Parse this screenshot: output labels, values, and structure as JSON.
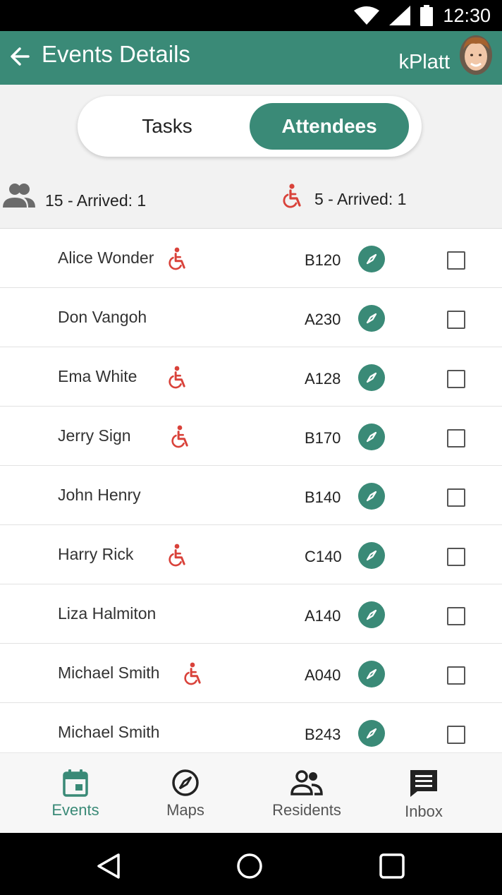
{
  "status_bar": {
    "time": "12:30"
  },
  "app_bar": {
    "title": "Events Details",
    "user": "kPlatt"
  },
  "tabs": [
    {
      "label": "Tasks",
      "active": false
    },
    {
      "label": "Attendees",
      "active": true
    }
  ],
  "counts": {
    "total": "15 - Arrived: 1",
    "wheelchair": "5 - Arrived: 1"
  },
  "attendees": [
    {
      "name": "Alice Wonder",
      "wheelchair": true,
      "room": "B120",
      "checked": false
    },
    {
      "name": "Don Vangoh",
      "wheelchair": false,
      "room": "A230",
      "checked": false
    },
    {
      "name": "Ema White",
      "wheelchair": true,
      "room": "A128",
      "checked": false
    },
    {
      "name": "Jerry Sign",
      "wheelchair": true,
      "room": "B170",
      "checked": false
    },
    {
      "name": "John Henry",
      "wheelchair": false,
      "room": "B140",
      "checked": false
    },
    {
      "name": "Harry Rick",
      "wheelchair": true,
      "room": "C140",
      "checked": false
    },
    {
      "name": "Liza Halmiton",
      "wheelchair": false,
      "room": "A140",
      "checked": false
    },
    {
      "name": "Michael Smith",
      "wheelchair": true,
      "room": "A040",
      "checked": false
    },
    {
      "name": "Michael Smith",
      "wheelchair": false,
      "room": "B243",
      "checked": false
    }
  ],
  "bottom_nav": [
    {
      "label": "Events",
      "icon": "calendar-icon",
      "active": true
    },
    {
      "label": "Maps",
      "icon": "compass-icon",
      "active": false
    },
    {
      "label": "Residents",
      "icon": "people-icon",
      "active": false
    },
    {
      "label": "Inbox",
      "icon": "message-icon",
      "active": false
    }
  ],
  "colors": {
    "primary": "#3a8a77",
    "accent_red": "#d9423a",
    "background": "#f2f2f2"
  }
}
